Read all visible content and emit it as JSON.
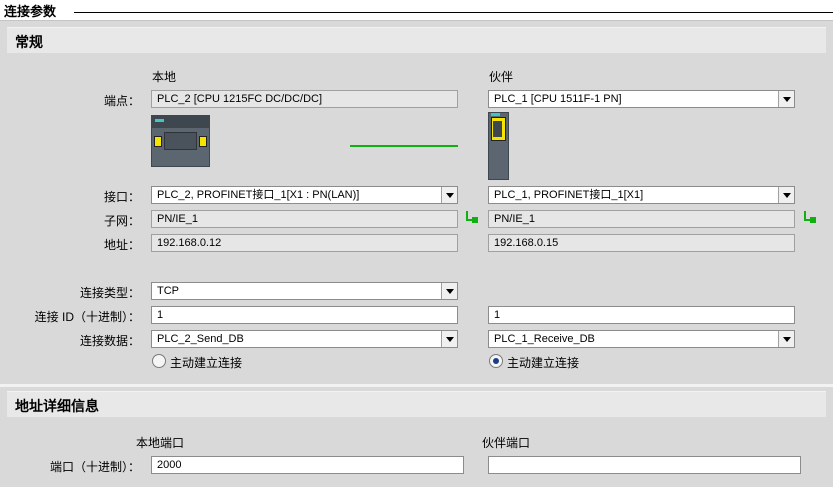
{
  "panel_title": "连接参数",
  "general": {
    "heading": "常规",
    "col_local": "本地",
    "col_partner": "伙伴",
    "labels": {
      "endpoint": "端点：",
      "interface": "接口：",
      "subnet": "子网：",
      "address": "地址：",
      "conn_type": "连接类型：",
      "conn_id": "连接 ID（十进制）：",
      "conn_data": "连接数据："
    },
    "local": {
      "endpoint": "PLC_2 [CPU 1215FC DC/DC/DC]",
      "interface": "PLC_2, PROFINET接口_1[X1 : PN(LAN)]",
      "subnet": "PN/IE_1",
      "address": "192.168.0.12",
      "conn_type": "TCP",
      "conn_id": "1",
      "conn_data": "PLC_2_Send_DB",
      "active_label": "主动建立连接",
      "active_selected": false
    },
    "partner": {
      "endpoint": "PLC_1 [CPU 1511F-1 PN]",
      "interface": "PLC_1, PROFINET接口_1[X1]",
      "subnet": "PN/IE_1",
      "address": "192.168.0.15",
      "conn_id": "1",
      "conn_data": "PLC_1_Receive_DB",
      "active_label": "主动建立连接",
      "active_selected": true
    }
  },
  "address_details": {
    "heading": "地址详细信息",
    "col_local": "本地端口",
    "col_partner": "伙伴端口",
    "port_label": "端口（十进制）：",
    "local_port": "2000",
    "partner_port": ""
  }
}
